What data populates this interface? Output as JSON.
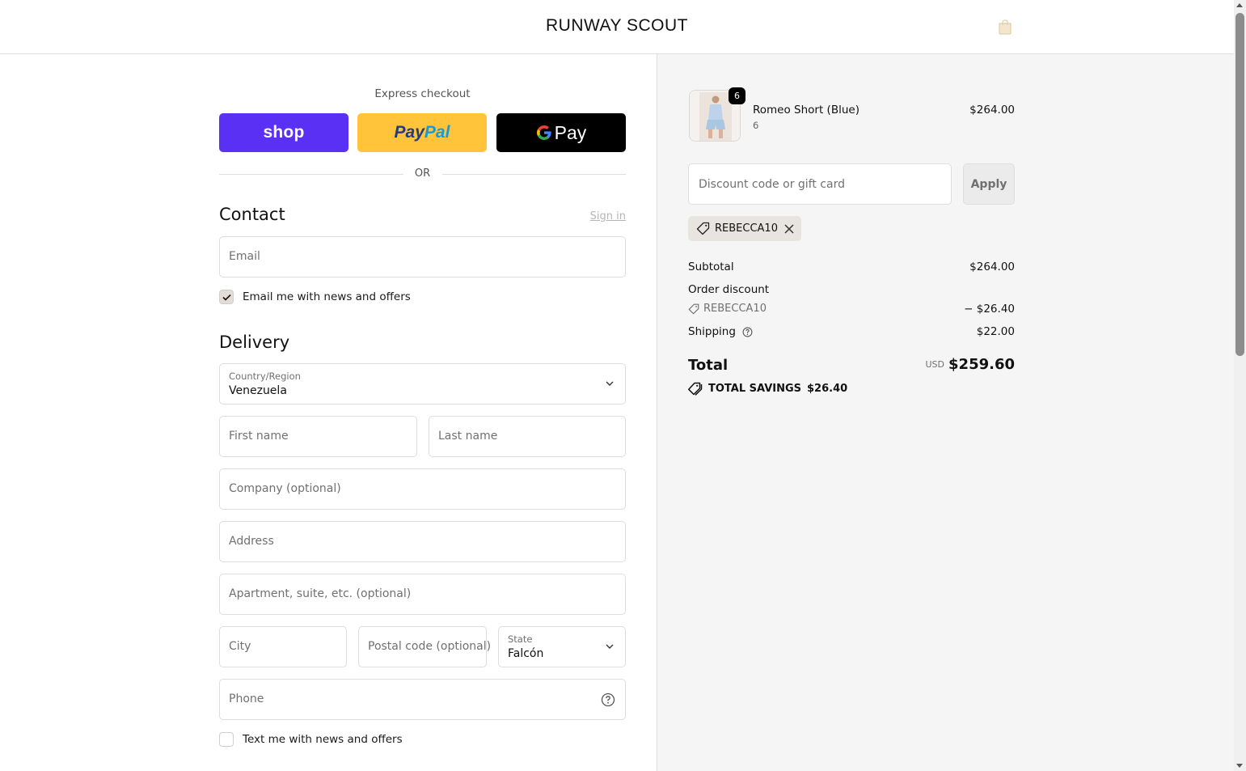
{
  "header": {
    "brand": "RUNWAY SCOUT",
    "cart_icon": "shopping-bag-icon"
  },
  "express": {
    "label": "Express checkout",
    "shop_label": "shop",
    "paypal_label_1": "Pay",
    "paypal_label_2": "Pal",
    "gpay_label": "Pay",
    "divider": "OR"
  },
  "contact": {
    "title": "Contact",
    "sign_in": "Sign in",
    "email_placeholder": "Email",
    "news_label": "Email me with news and offers",
    "news_checked": true
  },
  "delivery": {
    "title": "Delivery",
    "country_label": "Country/Region",
    "country_value": "Venezuela",
    "first_name": "First name",
    "last_name": "Last name",
    "company": "Company (optional)",
    "address": "Address",
    "apartment": "Apartment, suite, etc. (optional)",
    "city": "City",
    "postal": "Postal code (optional)",
    "state_label": "State",
    "state_value": "Falcón",
    "phone": "Phone",
    "sms_label": "Text me with news and offers",
    "sms_checked": false
  },
  "summary": {
    "item": {
      "quantity": "6",
      "name": "Romeo Short (Blue)",
      "variant": "6",
      "price": "$264.00"
    },
    "discount_placeholder": "Discount code or gift card",
    "apply": "Apply",
    "applied_code": "REBECCA10",
    "subtotal_label": "Subtotal",
    "subtotal_value": "$264.00",
    "order_discount_label": "Order discount",
    "order_discount_code": "REBECCA10",
    "order_discount_value": "− $26.40",
    "shipping_label": "Shipping",
    "shipping_value": "$22.00",
    "total_label": "Total",
    "currency": "USD",
    "total_value": "$259.60",
    "savings_label": "TOTAL SAVINGS",
    "savings_value": "$26.40"
  },
  "colors": {
    "shop_purple": "#5a31f4",
    "paypal_yellow": "#ffc439",
    "summary_bg": "#f5f5f5",
    "tag_bg": "#e8e4df"
  }
}
